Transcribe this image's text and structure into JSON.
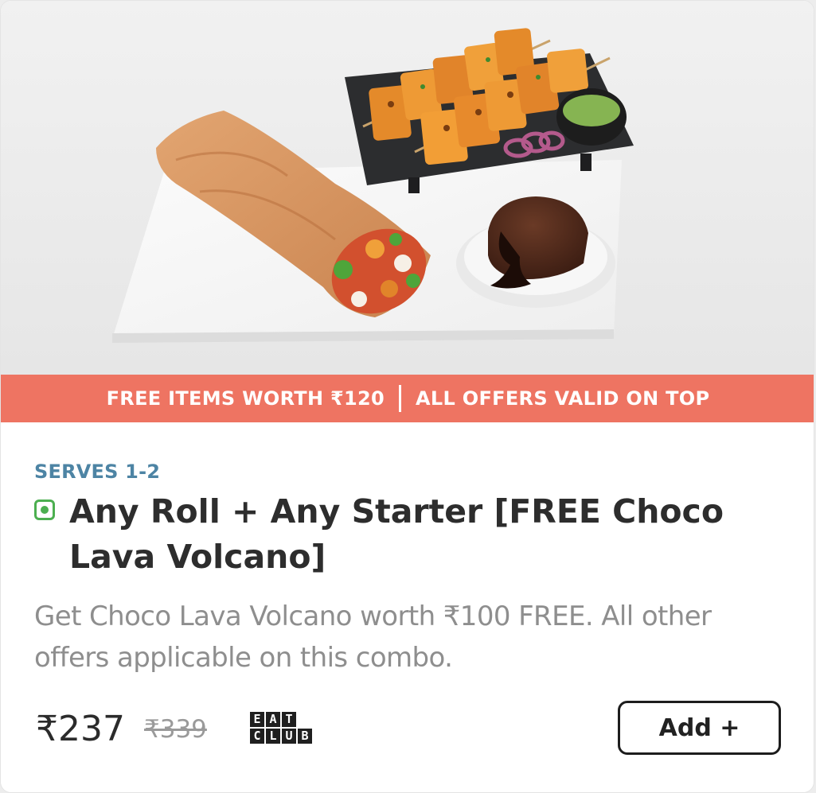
{
  "banner": {
    "left_text": "FREE ITEMS WORTH ₹120",
    "right_text": "ALL OFFERS VALID ON TOP"
  },
  "item": {
    "serves": "SERVES 1-2",
    "veg_icon": "veg-indicator-icon",
    "title": "Any Roll + Any Starter [FREE Choco Lava Volcano]",
    "description": "Get Choco Lava Volcano worth ₹100 FREE. All other offers applicable on this combo.",
    "price": "₹237",
    "original_price": "₹339",
    "badge_top": [
      "E",
      "A",
      "T"
    ],
    "badge_bottom": [
      "C",
      "L",
      "U",
      "B"
    ],
    "add_label": "Add +"
  },
  "colors": {
    "banner": "#ee7462",
    "serves": "#4d84a4",
    "veg": "#4caf50"
  }
}
